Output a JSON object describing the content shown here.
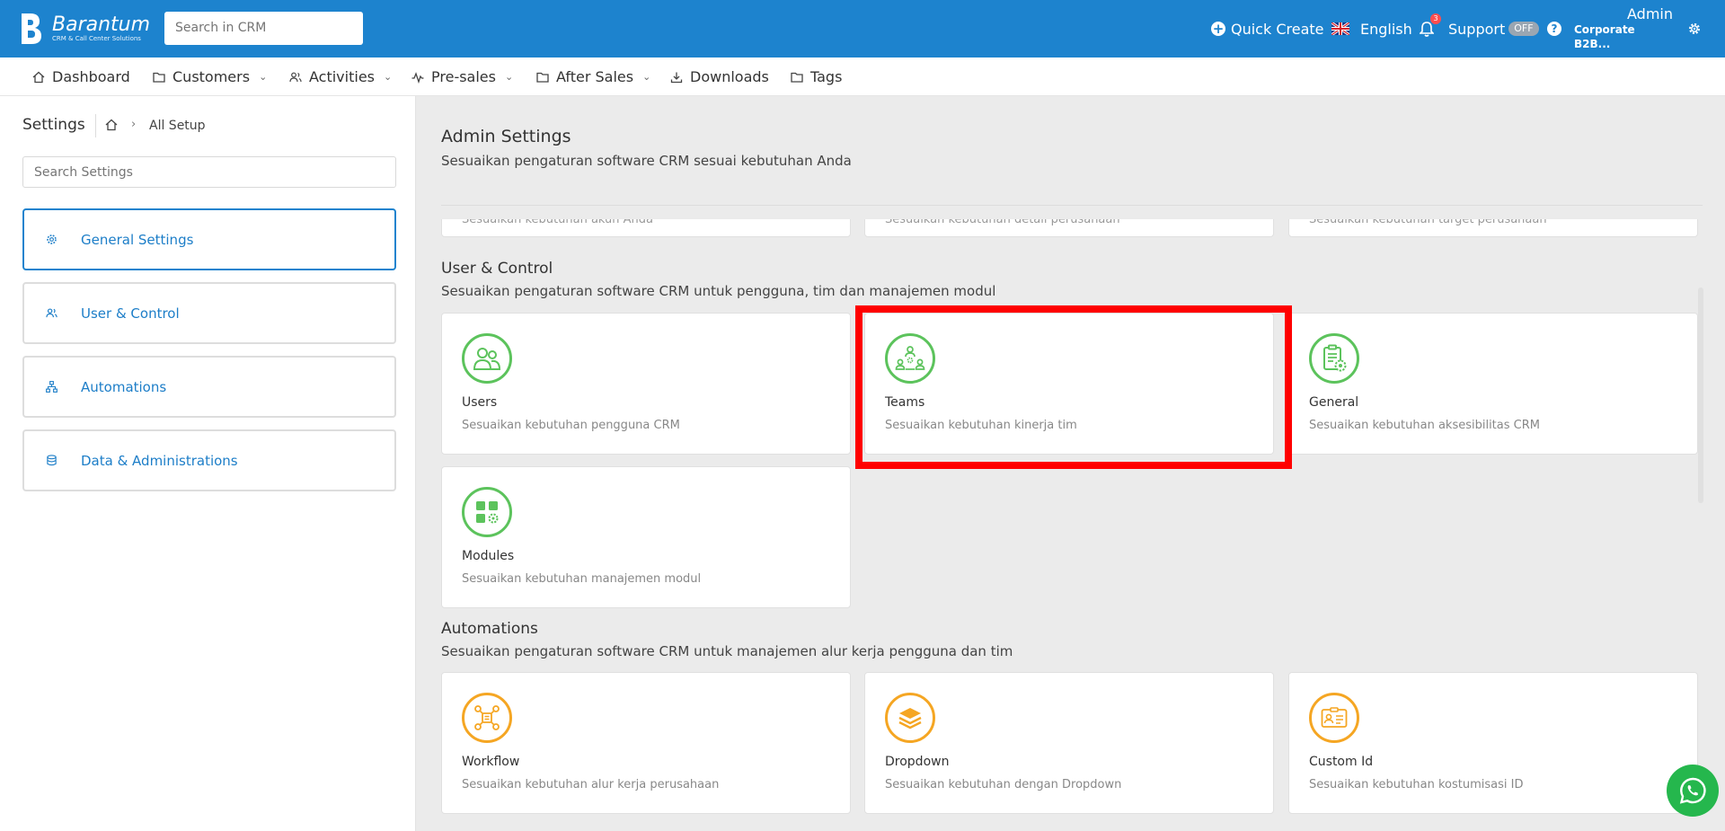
{
  "header": {
    "logo_name": "Barantum",
    "logo_tagline": "CRM & Call Center Solutions",
    "search_placeholder": "Search in CRM",
    "quick_create": "Quick Create",
    "language": "English",
    "notification_count": "3",
    "support": "Support",
    "support_toggle": "OFF",
    "help": "?",
    "user_name": "Admin",
    "user_org": "Corporate B2B..."
  },
  "nav": {
    "items": [
      {
        "label": "Dashboard",
        "icon": "home-icon",
        "dropdown": false
      },
      {
        "label": "Customers",
        "icon": "folder-icon",
        "dropdown": true
      },
      {
        "label": "Activities",
        "icon": "users-icon",
        "dropdown": true
      },
      {
        "label": "Pre-sales",
        "icon": "pulse-icon",
        "dropdown": true
      },
      {
        "label": "After Sales",
        "icon": "folder-icon",
        "dropdown": true
      },
      {
        "label": "Downloads",
        "icon": "download-icon",
        "dropdown": false
      },
      {
        "label": "Tags",
        "icon": "folder-icon",
        "dropdown": false
      }
    ]
  },
  "sidebar": {
    "title": "Settings",
    "breadcrumb": "All Setup",
    "search_placeholder": "Search Settings",
    "menu": [
      {
        "label": "General Settings",
        "icon": "gear-icon",
        "active": true
      },
      {
        "label": "User & Control",
        "icon": "users-icon",
        "active": false
      },
      {
        "label": "Automations",
        "icon": "hierarchy-icon",
        "active": false
      },
      {
        "label": "Data & Administrations",
        "icon": "database-icon",
        "active": false
      }
    ]
  },
  "main": {
    "title": "Admin Settings",
    "subtitle": "Sesuaikan pengaturan software CRM sesuai kebutuhan Anda",
    "clipped_cards": [
      "Sesuaikan kebutuhan akun Anda",
      "Sesuaikan kebutuhan detail perusahaan",
      "Sesuaikan kebutuhan target perusahaan"
    ],
    "user_control": {
      "title": "User & Control",
      "subtitle": "Sesuaikan pengaturan software CRM untuk pengguna, tim dan manajemen modul",
      "cards": [
        {
          "title": "Users",
          "desc": "Sesuaikan kebutuhan pengguna CRM",
          "icon": "users-icon"
        },
        {
          "title": "Teams",
          "desc": "Sesuaikan kebutuhan kinerja tim",
          "icon": "team-icon"
        },
        {
          "title": "General",
          "desc": "Sesuaikan kebutuhan aksesibilitas CRM",
          "icon": "clipboard-gear-icon"
        },
        {
          "title": "Modules",
          "desc": "Sesuaikan kebutuhan manajemen modul",
          "icon": "modules-icon"
        }
      ]
    },
    "automations": {
      "title": "Automations",
      "subtitle": "Sesuaikan pengaturan software CRM untuk manajemen alur kerja pengguna dan tim",
      "cards": [
        {
          "title": "Workflow",
          "desc": "Sesuaikan kebutuhan alur kerja perusahaan",
          "icon": "workflow-icon"
        },
        {
          "title": "Dropdown",
          "desc": "Sesuaikan kebutuhan dengan Dropdown",
          "icon": "layers-icon"
        },
        {
          "title": "Custom Id",
          "desc": "Sesuaikan kebutuhan kostumisasi ID",
          "icon": "id-card-icon"
        }
      ]
    }
  },
  "colors": {
    "brand": "#1d83ce",
    "green": "#5cc35c",
    "orange": "#f5a623",
    "highlight": "#ff0000",
    "whatsapp": "#25b74d"
  }
}
